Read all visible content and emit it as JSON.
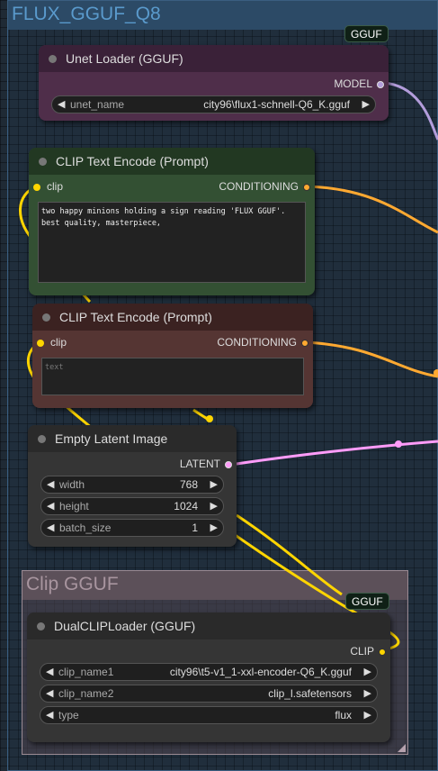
{
  "groups": {
    "main": {
      "title": "FLUX_GGUF_Q8"
    },
    "clip": {
      "title": "Clip GGUF"
    }
  },
  "badges": {
    "unet": "GGUF",
    "clip": "GGUF"
  },
  "nodes": {
    "unet_loader": {
      "title": "Unet Loader (GGUF)",
      "output": "MODEL",
      "widgets": [
        {
          "name": "unet_name",
          "value": "city96\\flux1-schnell-Q6_K.gguf"
        }
      ]
    },
    "clip_encode_pos": {
      "title": "CLIP Text Encode (Prompt)",
      "input": "clip",
      "output": "CONDITIONING",
      "text": "two happy minions holding a sign reading 'FLUX GGUF'.\nbest quality, masterpiece,"
    },
    "clip_encode_neg": {
      "title": "CLIP Text Encode (Prompt)",
      "input": "clip",
      "output": "CONDITIONING",
      "placeholder": "text"
    },
    "empty_latent": {
      "title": "Empty Latent Image",
      "output": "LATENT",
      "widgets": [
        {
          "name": "width",
          "value": "768"
        },
        {
          "name": "height",
          "value": "1024"
        },
        {
          "name": "batch_size",
          "value": "1"
        }
      ]
    },
    "dual_clip": {
      "title": "DualCLIPLoader (GGUF)",
      "output": "CLIP",
      "widgets": [
        {
          "name": "clip_name1",
          "value": "city96\\t5-v1_1-xxl-encoder-Q6_K.gguf"
        },
        {
          "name": "clip_name2",
          "value": "clip_l.safetensors"
        },
        {
          "name": "type",
          "value": "flux"
        }
      ]
    }
  },
  "colors": {
    "model_wire": "#b39ddb",
    "conditioning_wire": "#ffa931",
    "latent_wire": "#ff9cf9",
    "clip_wire": "#ffd500"
  },
  "icons": {
    "left_arrow": "◀",
    "right_arrow": "▶"
  }
}
